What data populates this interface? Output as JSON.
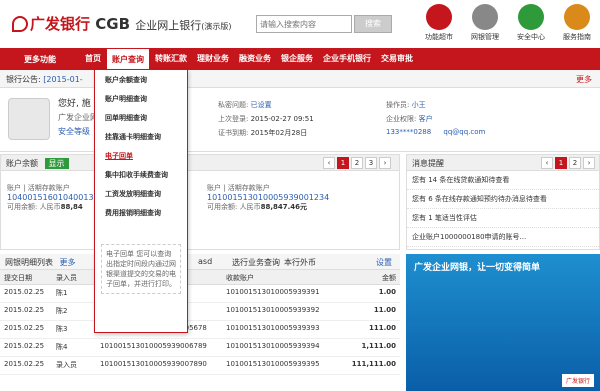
{
  "header": {
    "logo_text": "广发银行",
    "logo_cgb": "CGB",
    "logo_sub": "企业网上银行",
    "logo_demo": "(演示版)",
    "search_placeholder": "请输入搜索内容",
    "search_button": "搜索",
    "quick_links": [
      {
        "label": "功能超市",
        "icon": "market-icon",
        "color": "#c4161c"
      },
      {
        "label": "网银管理",
        "icon": "gear-icon",
        "color": "#888888"
      },
      {
        "label": "安全中心",
        "icon": "shield-icon",
        "color": "#2f9a3a"
      },
      {
        "label": "服务指南",
        "icon": "signpost-icon",
        "color": "#d98a1a"
      }
    ]
  },
  "nav": {
    "more": "更多功能",
    "items": [
      "首页",
      "账户查询",
      "转账汇款",
      "理财业务",
      "融资业务",
      "银企服务",
      "企业手机银行",
      "交易审批"
    ],
    "active_index": 1
  },
  "notice": {
    "label": "银行公告:",
    "date": "[2015-01-",
    "more": "更多"
  },
  "profile": {
    "greet": "您好, 施",
    "company": "广发企业网",
    "security": "安全等级",
    "private_q_label": "私密问题:",
    "private_q_value": "已设置",
    "last_login_label": "上次登录:",
    "last_login_value": "2015-02-27 09:51",
    "cert_label": "证书到期:",
    "cert_value": "2015年02月28日",
    "user_label": "操作员:",
    "user_value": "小王",
    "role_label": "企业权限:",
    "role_value": "客户",
    "phone": "133****0288",
    "email": "qq@qq.com"
  },
  "accounts": {
    "title": "账户余额",
    "toggle": "显示",
    "pages": [
      "1",
      "2",
      "3"
    ],
    "list": [
      {
        "label": "账户",
        "tag": "活期存款账户",
        "number": "10400151601040013",
        "bal_label": "可用余额: 人民币",
        "bal": "88,84"
      },
      {
        "label": "账户",
        "tag": "活期存款账户",
        "number": "101001513010005939001234",
        "bal_label": "可用余额: 人民币",
        "bal": "88,847.46元"
      }
    ]
  },
  "messages": {
    "title": "消息提醒",
    "pages": [
      "1",
      "2"
    ],
    "items": [
      "您有 14 条在线贷款通知待查看",
      "您有 6 条在线存款通知预约待办消息待查看",
      "您有 1 笔适当性评估",
      "企业账户1000000180申请的账号..."
    ]
  },
  "table": {
    "title": "网银明细列表",
    "more": "更多",
    "tools": [
      "asd",
      "选行业务查询",
      "本行外币",
      "设置"
    ],
    "pages": [
      "1",
      "2"
    ],
    "headers": [
      "提交日期",
      "录入员",
      "",
      "收款账户",
      "金额"
    ],
    "rows": [
      [
        "2015.02.25",
        "陈1",
        "",
        "101001513010005939391",
        "1.00"
      ],
      [
        "2015.02.25",
        "陈2",
        "4567",
        "101001513010005939392",
        "11.00"
      ],
      [
        "2015.02.25",
        "陈3",
        "101001513010005939005678",
        "101001513010005939393",
        "111.00"
      ],
      [
        "2015.02.25",
        "陈4",
        "101001513010005939006789",
        "101001513010005939394",
        "1,111.00"
      ],
      [
        "2015.02.25",
        "录入员",
        "101001513010005939007890",
        "101001513010005939395",
        "111,111.00"
      ]
    ]
  },
  "banner": {
    "title": "广发企业网银，让一切变得简单",
    "logo": "广发银行"
  },
  "dropdown": {
    "items": [
      "账户余额查询",
      "账户明细查询",
      "回单明细查询",
      "挂靠通卡明细查询",
      "电子回单",
      "集中扣收手续费查询",
      "工资发放明细查询",
      "费用报销明细查询"
    ],
    "highlight_index": 4,
    "desc": "电子回单 您可以查询出指定时间段内通过网银渠道提交的交易的电子回单，并进行打印。"
  }
}
